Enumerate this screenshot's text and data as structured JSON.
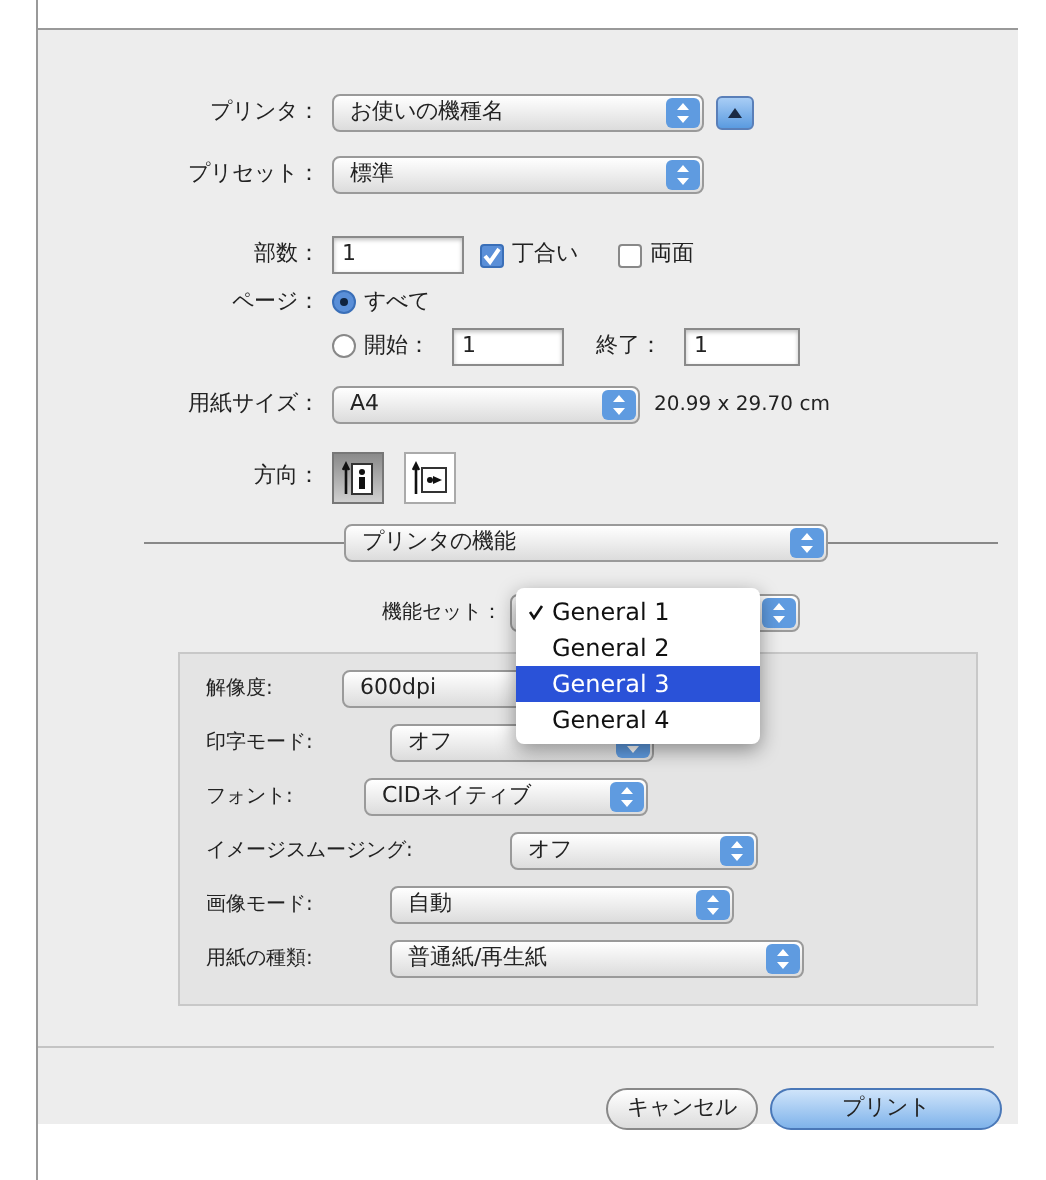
{
  "printer": {
    "label": "プリンタ：",
    "value": "お使いの機種名"
  },
  "preset": {
    "label": "プリセット：",
    "value": "標準"
  },
  "copies": {
    "label": "部数：",
    "value": "1"
  },
  "collate": {
    "label": "丁合い",
    "checked": true
  },
  "two_sided": {
    "label": "両面",
    "checked": false
  },
  "pages": {
    "label": "ページ：",
    "options": [
      {
        "label": "すべて",
        "selected": true
      },
      {
        "label": "開始：",
        "selected": false
      }
    ],
    "from": "1",
    "to_label": "終了：",
    "to": "1"
  },
  "paper_size": {
    "label": "用紙サイズ：",
    "value": "A4",
    "dimensions": "20.99 x 29.70 cm"
  },
  "orientation": {
    "label": "方向：",
    "options": [
      {
        "kind": "portrait",
        "selected": true
      },
      {
        "kind": "landscape",
        "selected": false
      }
    ]
  },
  "section_popup": {
    "value": "プリンタの機能"
  },
  "feature_set": {
    "label": "機能セット：",
    "menu": [
      {
        "label": "General 1",
        "checked": true,
        "selected": false
      },
      {
        "label": "General 2",
        "checked": false,
        "selected": false
      },
      {
        "label": "General 3",
        "checked": false,
        "selected": true
      },
      {
        "label": "General 4",
        "checked": false,
        "selected": false
      }
    ]
  },
  "settings": [
    {
      "label": "解像度:",
      "value": "600dpi"
    },
    {
      "label": "印字モード:",
      "value": "オフ"
    },
    {
      "label": "フォント:",
      "value": "CIDネイティブ"
    },
    {
      "label": "イメージスムージング:",
      "value": "オフ"
    },
    {
      "label": "画像モード:",
      "value": "自動"
    },
    {
      "label": "用紙の種類:",
      "value": "普通紙/再生紙"
    }
  ],
  "buttons": [
    {
      "label": "キャンセル",
      "kind": "cancel"
    },
    {
      "label": "プリント",
      "kind": "default"
    }
  ]
}
